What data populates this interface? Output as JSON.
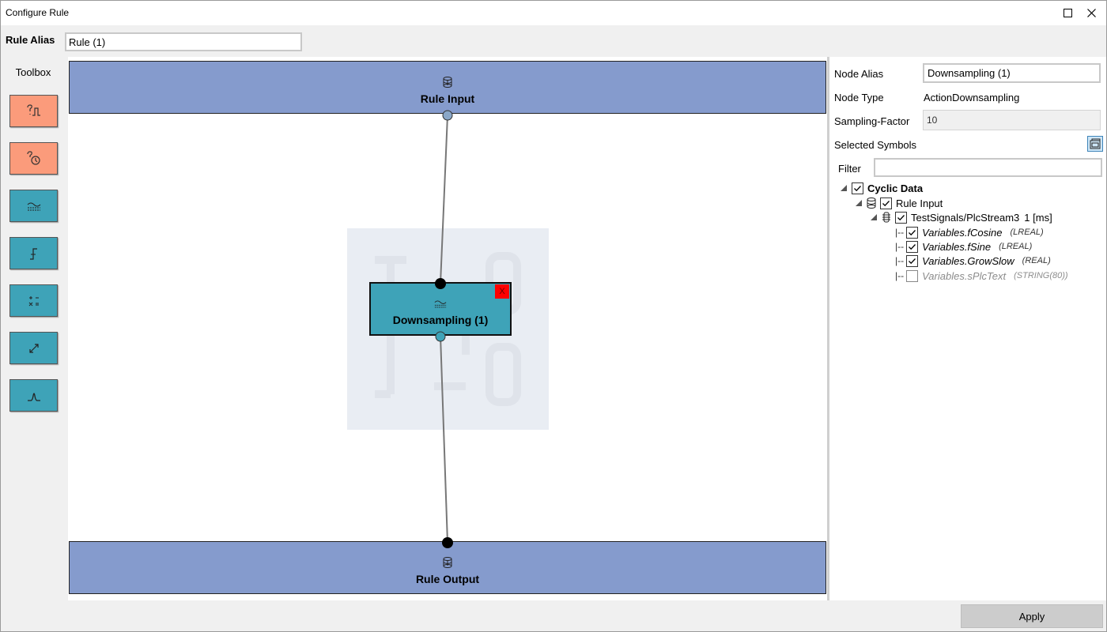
{
  "window": {
    "title": "Configure Rule",
    "controls": {
      "maximize_icon": "maximize-icon",
      "close_icon": "close-icon"
    }
  },
  "rule_alias": {
    "label": "Rule Alias",
    "value": "Rule (1)"
  },
  "toolbox": {
    "title": "Toolbox",
    "tools": [
      {
        "icon": "condition-icon",
        "color": "#fb9b7b"
      },
      {
        "icon": "trigger-icon",
        "color": "#fb9b7b"
      },
      {
        "icon": "downsampling-icon",
        "color": "#3ea3b8"
      },
      {
        "icon": "step-icon",
        "color": "#3ea3b8"
      },
      {
        "icon": "math-operators-icon",
        "color": "#3ea3b8"
      },
      {
        "icon": "scale-icon",
        "color": "#3ea3b8"
      },
      {
        "icon": "peak-icon",
        "color": "#3ea3b8"
      }
    ]
  },
  "canvas": {
    "input_block": {
      "label": "Rule Input",
      "color": "#859bcd"
    },
    "node": {
      "label": "Downsampling (1)",
      "close_label": "X",
      "color": "#3ea3b8"
    },
    "output_block": {
      "label": "Rule Output",
      "color": "#859bcd"
    }
  },
  "properties": {
    "node_alias": {
      "label": "Node Alias",
      "value": "Downsampling (1)"
    },
    "node_type": {
      "label": "Node Type",
      "value": "ActionDownsampling"
    },
    "sampling_factor": {
      "label": "Sampling-Factor",
      "value": "10"
    },
    "selected_symbols": {
      "label": "Selected Symbols"
    },
    "filter": {
      "label": "Filter",
      "value": ""
    },
    "tree": {
      "root": {
        "label": "Cyclic Data",
        "checked": true
      },
      "input": {
        "label": "Rule Input",
        "checked": true
      },
      "stream": {
        "label": "TestSignals/PlcStream3",
        "rate": "1 [ms]",
        "checked": true
      },
      "symbols": [
        {
          "prefix": "|--",
          "name": "Variables.fCosine",
          "type": "(LREAL)",
          "checked": true
        },
        {
          "prefix": "|--",
          "name": "Variables.fSine",
          "type": "(LREAL)",
          "checked": true
        },
        {
          "prefix": "|--",
          "name": "Variables.GrowSlow",
          "type": "(REAL)",
          "checked": true
        },
        {
          "prefix": "|--",
          "name": "Variables.sPlcText",
          "type": "(STRING(80))",
          "checked": false
        }
      ]
    }
  },
  "footer": {
    "apply_label": "Apply"
  }
}
